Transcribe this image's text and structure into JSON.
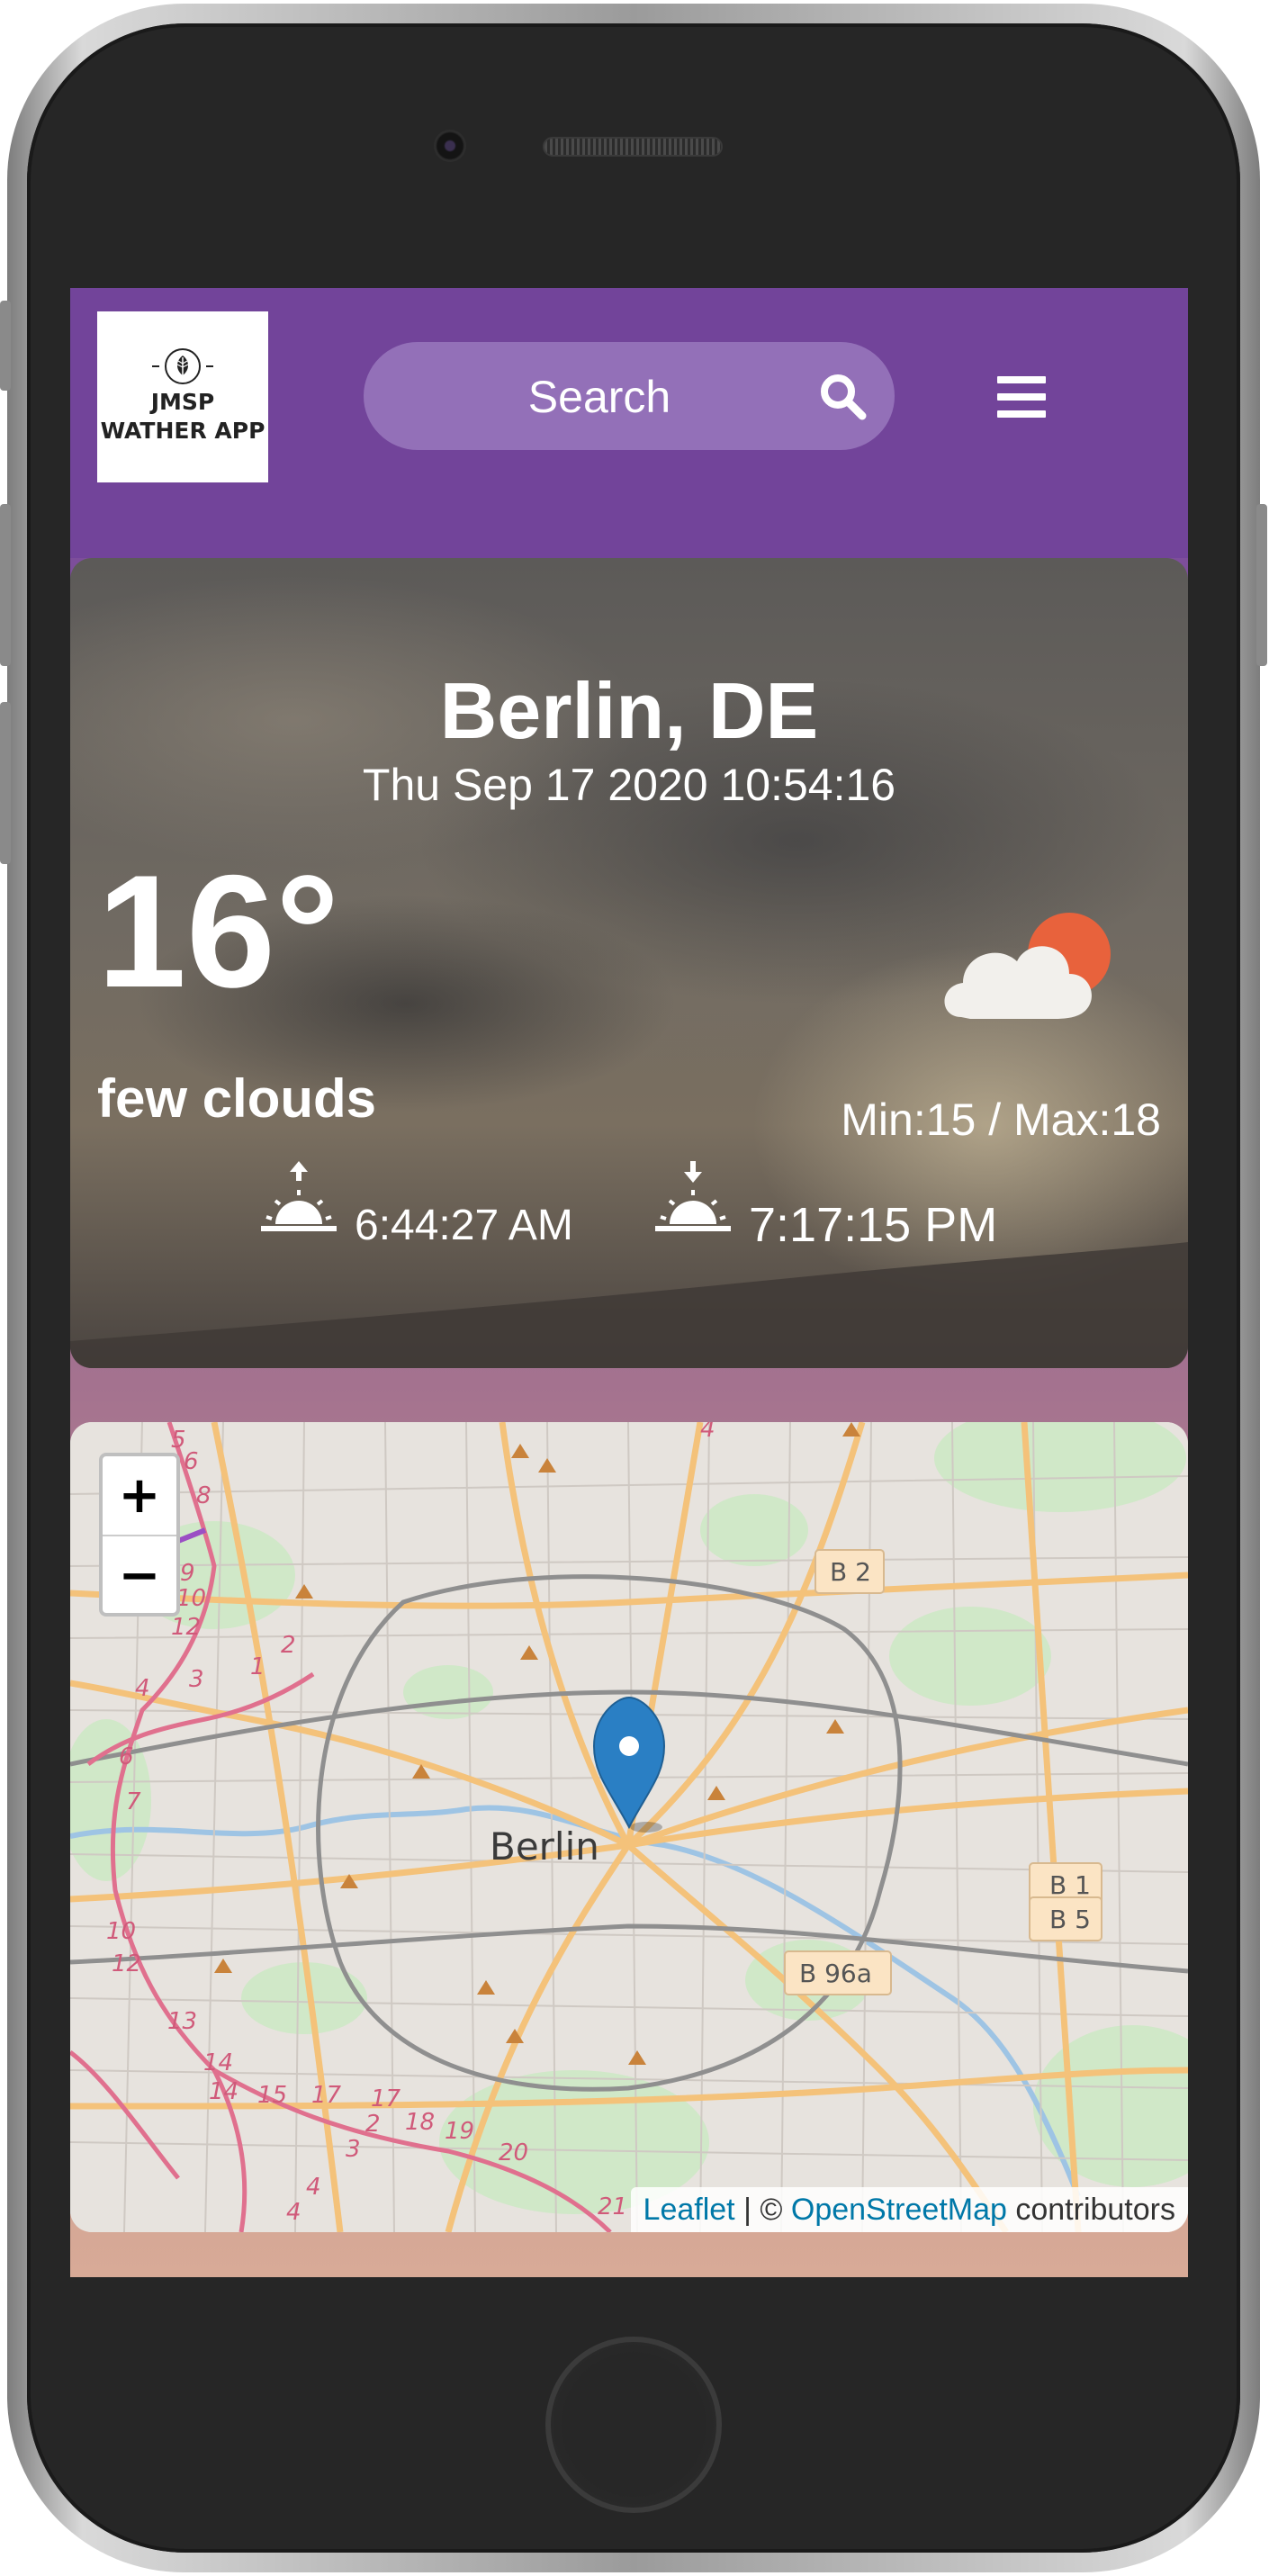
{
  "navbar": {
    "logo_line1": "JMSP",
    "logo_line2": "WATHER APP",
    "search_placeholder": "Search",
    "search_icon": "search-icon",
    "menu_icon": "hamburger-menu-icon"
  },
  "weather": {
    "city": "Berlin, DE",
    "datetime": "Thu Sep 17 2020 10:54:16",
    "temperature": "16°",
    "icon": "few-clouds-icon",
    "condition": "few clouds",
    "minmax": "Min:15 / Max:18",
    "sunrise": "6:44:27 AM",
    "sunset": "7:17:15 PM"
  },
  "map": {
    "zoom_in": "+",
    "zoom_out": "−",
    "city_label": "Berlin",
    "road_labels": [
      "B 2",
      "B 1",
      "B 5",
      "B 96a"
    ],
    "attribution_leaflet": "Leaflet",
    "attribution_sep": " | © ",
    "attribution_osm": "OpenStreetMap",
    "attribution_suffix": " contributors"
  },
  "colors": {
    "navbar": "#72449a",
    "search_pill": "#9370b8",
    "sun": "#e8623c",
    "pin": "#2a7fc4",
    "link": "#0078a8"
  }
}
